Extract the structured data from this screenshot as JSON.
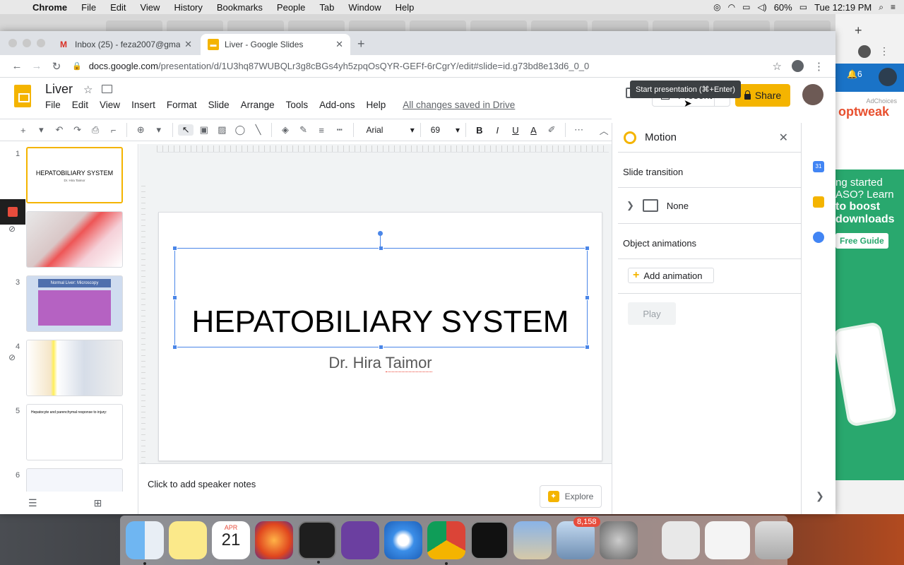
{
  "mac_menubar": {
    "app_name": "Chrome",
    "menus": [
      "File",
      "Edit",
      "View",
      "History",
      "Bookmarks",
      "People",
      "Tab",
      "Window",
      "Help"
    ],
    "battery": "60%",
    "clock": "Tue 12:19 PM"
  },
  "browser": {
    "tabs": [
      {
        "title": "Inbox (25) - feza2007@gmail.c",
        "favicon": "gmail-icon"
      },
      {
        "title": "Liver - Google Slides",
        "favicon": "slides-icon"
      }
    ],
    "url_host": "docs.google.com",
    "url_path": "/presentation/d/1U3hq87WUBQLr3g8cBGs4yh5zpqOsQYR-GEFf-6rCgrY/edit#slide=id.g73bd8e13d6_0_0"
  },
  "slides": {
    "doc_title": "Liver",
    "menus": [
      "File",
      "Edit",
      "View",
      "Insert",
      "Format",
      "Slide",
      "Arrange",
      "Tools",
      "Add-ons",
      "Help"
    ],
    "saved_status": "All changes saved in Drive",
    "present_label": "Present",
    "share_label": "Share",
    "tooltip": "Start presentation (⌘+Enter)",
    "toolbar": {
      "font": "Arial",
      "font_size": "69"
    },
    "filmstrip": [
      {
        "num": "1",
        "title": "HEPATOBILIARY SYSTEM",
        "subtitle": "Dr. Hira Taimor",
        "selected": true
      },
      {
        "num": "2",
        "title": "",
        "has_motion": true
      },
      {
        "num": "3",
        "title": "Normal Liver: Microscopy"
      },
      {
        "num": "4",
        "title": "",
        "has_motion": true
      },
      {
        "num": "5",
        "title": "Hepatocyte and parenchymal response to injury:"
      },
      {
        "num": "6",
        "title": ""
      }
    ],
    "current_slide": {
      "title": "HEPATOBILIARY SYSTEM",
      "subtitle_first": "Dr. Hira ",
      "subtitle_flagged": "Taimor"
    },
    "notes_placeholder": "Click to add speaker notes",
    "explore_label": "Explore",
    "motion_panel": {
      "title": "Motion",
      "slide_transition_label": "Slide transition",
      "transition_value": "None",
      "object_animations_label": "Object animations",
      "add_animation_label": "Add animation",
      "play_label": "Play"
    }
  },
  "ad": {
    "ad_choices": "AdChoices",
    "brand": "optweak",
    "line1": "ng started",
    "line2": "ASO? Learn",
    "line3": "to boost",
    "line4": "downloads",
    "button": "Free Guide",
    "notification_count": "6"
  },
  "dock": {
    "calendar_month": "APR",
    "calendar_day": "21",
    "mail_badge": "8,158"
  },
  "colors": {
    "accent": "#f4b400",
    "selection": "#4a86e8"
  }
}
